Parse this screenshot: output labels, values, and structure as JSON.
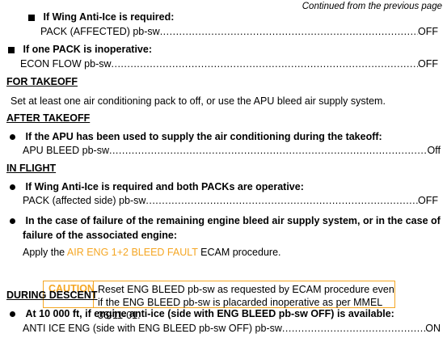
{
  "page": {
    "continued": "Continued from the previous page"
  },
  "wing_anti_ice": {
    "condition": "If Wing Anti-Ice is required:",
    "item": "PACK (AFFECTED) pb-sw",
    "value": "OFF"
  },
  "one_pack_inop": {
    "condition": "If one PACK is inoperative:",
    "item": "ECON FLOW pb-sw",
    "value": "OFF"
  },
  "for_takeoff": {
    "heading": "FOR TAKEOFF",
    "text": "Set at least one air conditioning pack to off, or use the APU bleed air supply system."
  },
  "after_takeoff": {
    "heading": "AFTER TAKEOFF",
    "condition": "If the APU has been used to supply the air conditioning during the takeoff:",
    "item": "APU BLEED pb-sw",
    "value": "Off"
  },
  "in_flight": {
    "heading": "IN FLIGHT",
    "wing_condition": "If Wing Anti-Ice is required and both PACKs are operative:",
    "wing_item": "PACK (affected side) pb-sw",
    "wing_value": "OFF",
    "failure_condition_line1": "In the case of failure of the remaining engine bleed air supply system, or in the case of",
    "failure_condition_line2": "failure of the associated engine:",
    "apply_prefix": "Apply the ",
    "apply_link": "AIR ENG 1+2 BLEED FAULT",
    "apply_suffix": " ECAM procedure.",
    "caution_label": "CAUTION",
    "caution_text": "Reset ENG BLEED pb-sw as requested by ECAM procedure even if the ENG BLEED pb-sw is placarded inoperative as per MMEL 36-11-01."
  },
  "during_descent": {
    "heading": "DURING DESCENT",
    "condition": "At 10 000 ft, if engine anti-ice (side with ENG BLEED pb-sw OFF) is available:",
    "item": "ANTI ICE ENG (side with ENG BLEED pb-sw OFF) pb-sw",
    "value": "ON"
  }
}
